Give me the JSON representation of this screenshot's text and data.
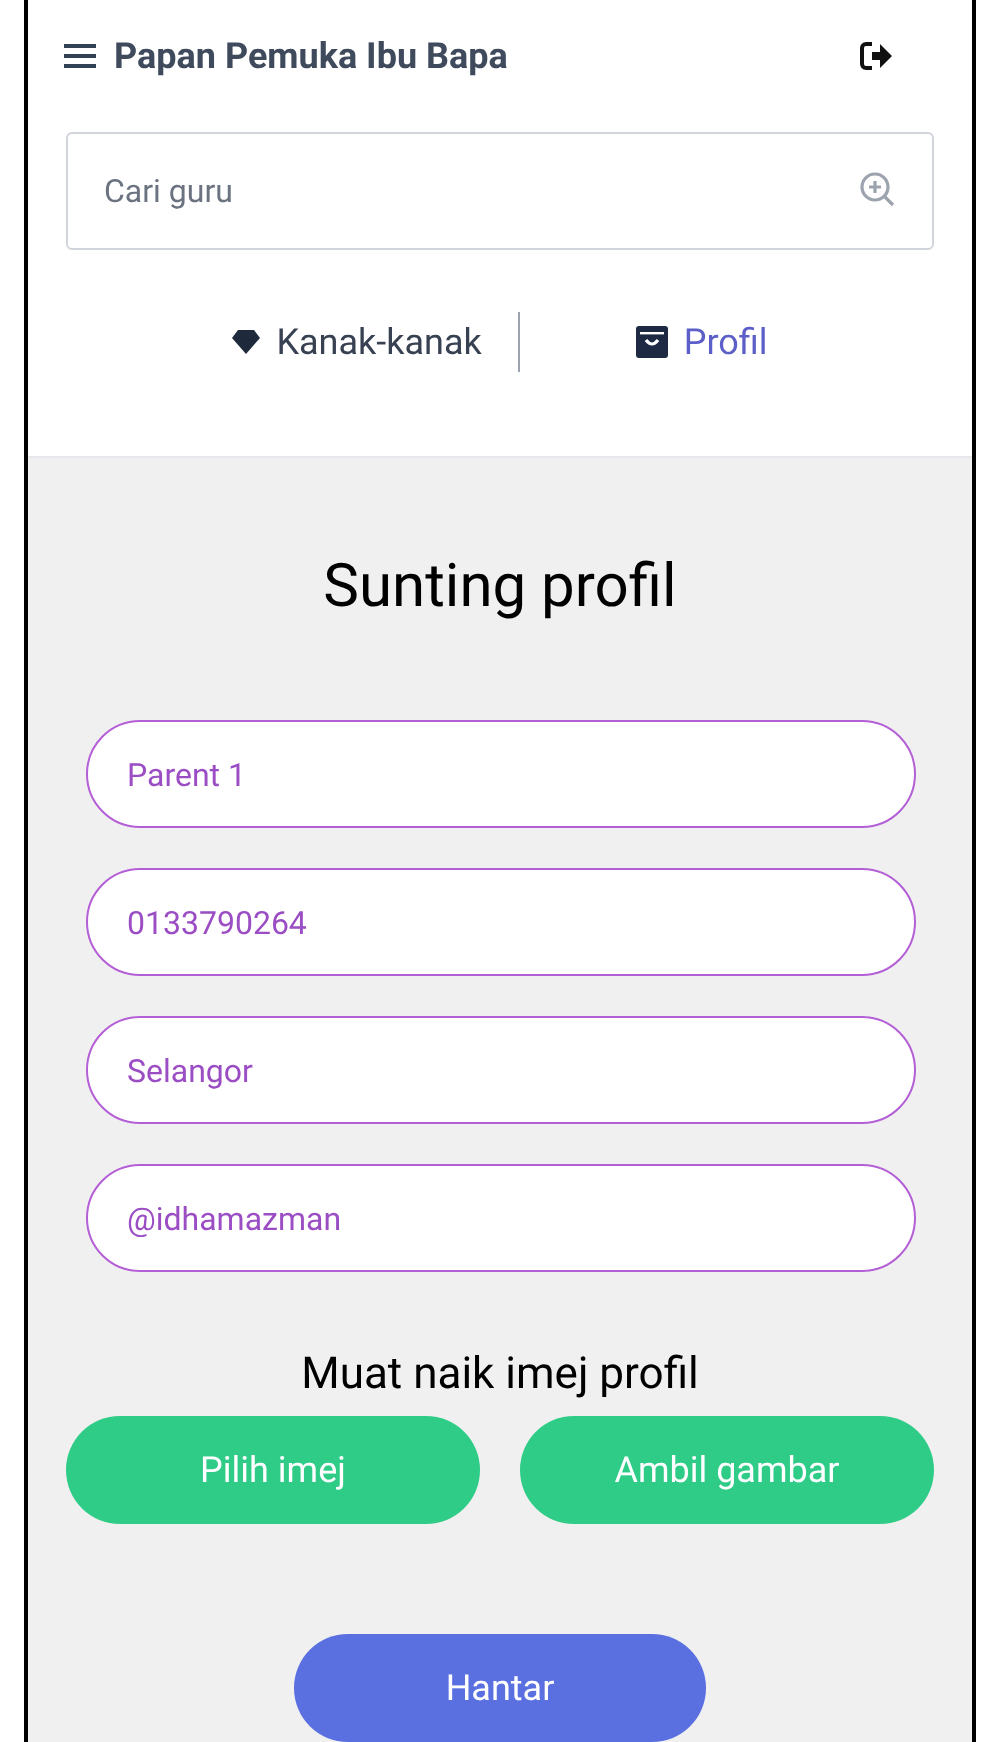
{
  "header": {
    "title": "Papan Pemuka Ibu Bapa"
  },
  "search": {
    "placeholder": "Cari guru"
  },
  "tabs": [
    {
      "label": "Kanak-kanak",
      "kind": "gem",
      "selected": false
    },
    {
      "label": "Profil",
      "kind": "bag",
      "selected": true
    }
  ],
  "form": {
    "title": "Sunting profil",
    "fields": [
      {
        "value": "Parent 1"
      },
      {
        "value": "0133790264"
      },
      {
        "value": "Selangor"
      },
      {
        "value": "@idhamazman"
      }
    ],
    "upload_label": "Muat naik imej profil",
    "upload_buttons": [
      "Pilih imej",
      "Ambil gambar"
    ],
    "submit": "Hantar"
  }
}
